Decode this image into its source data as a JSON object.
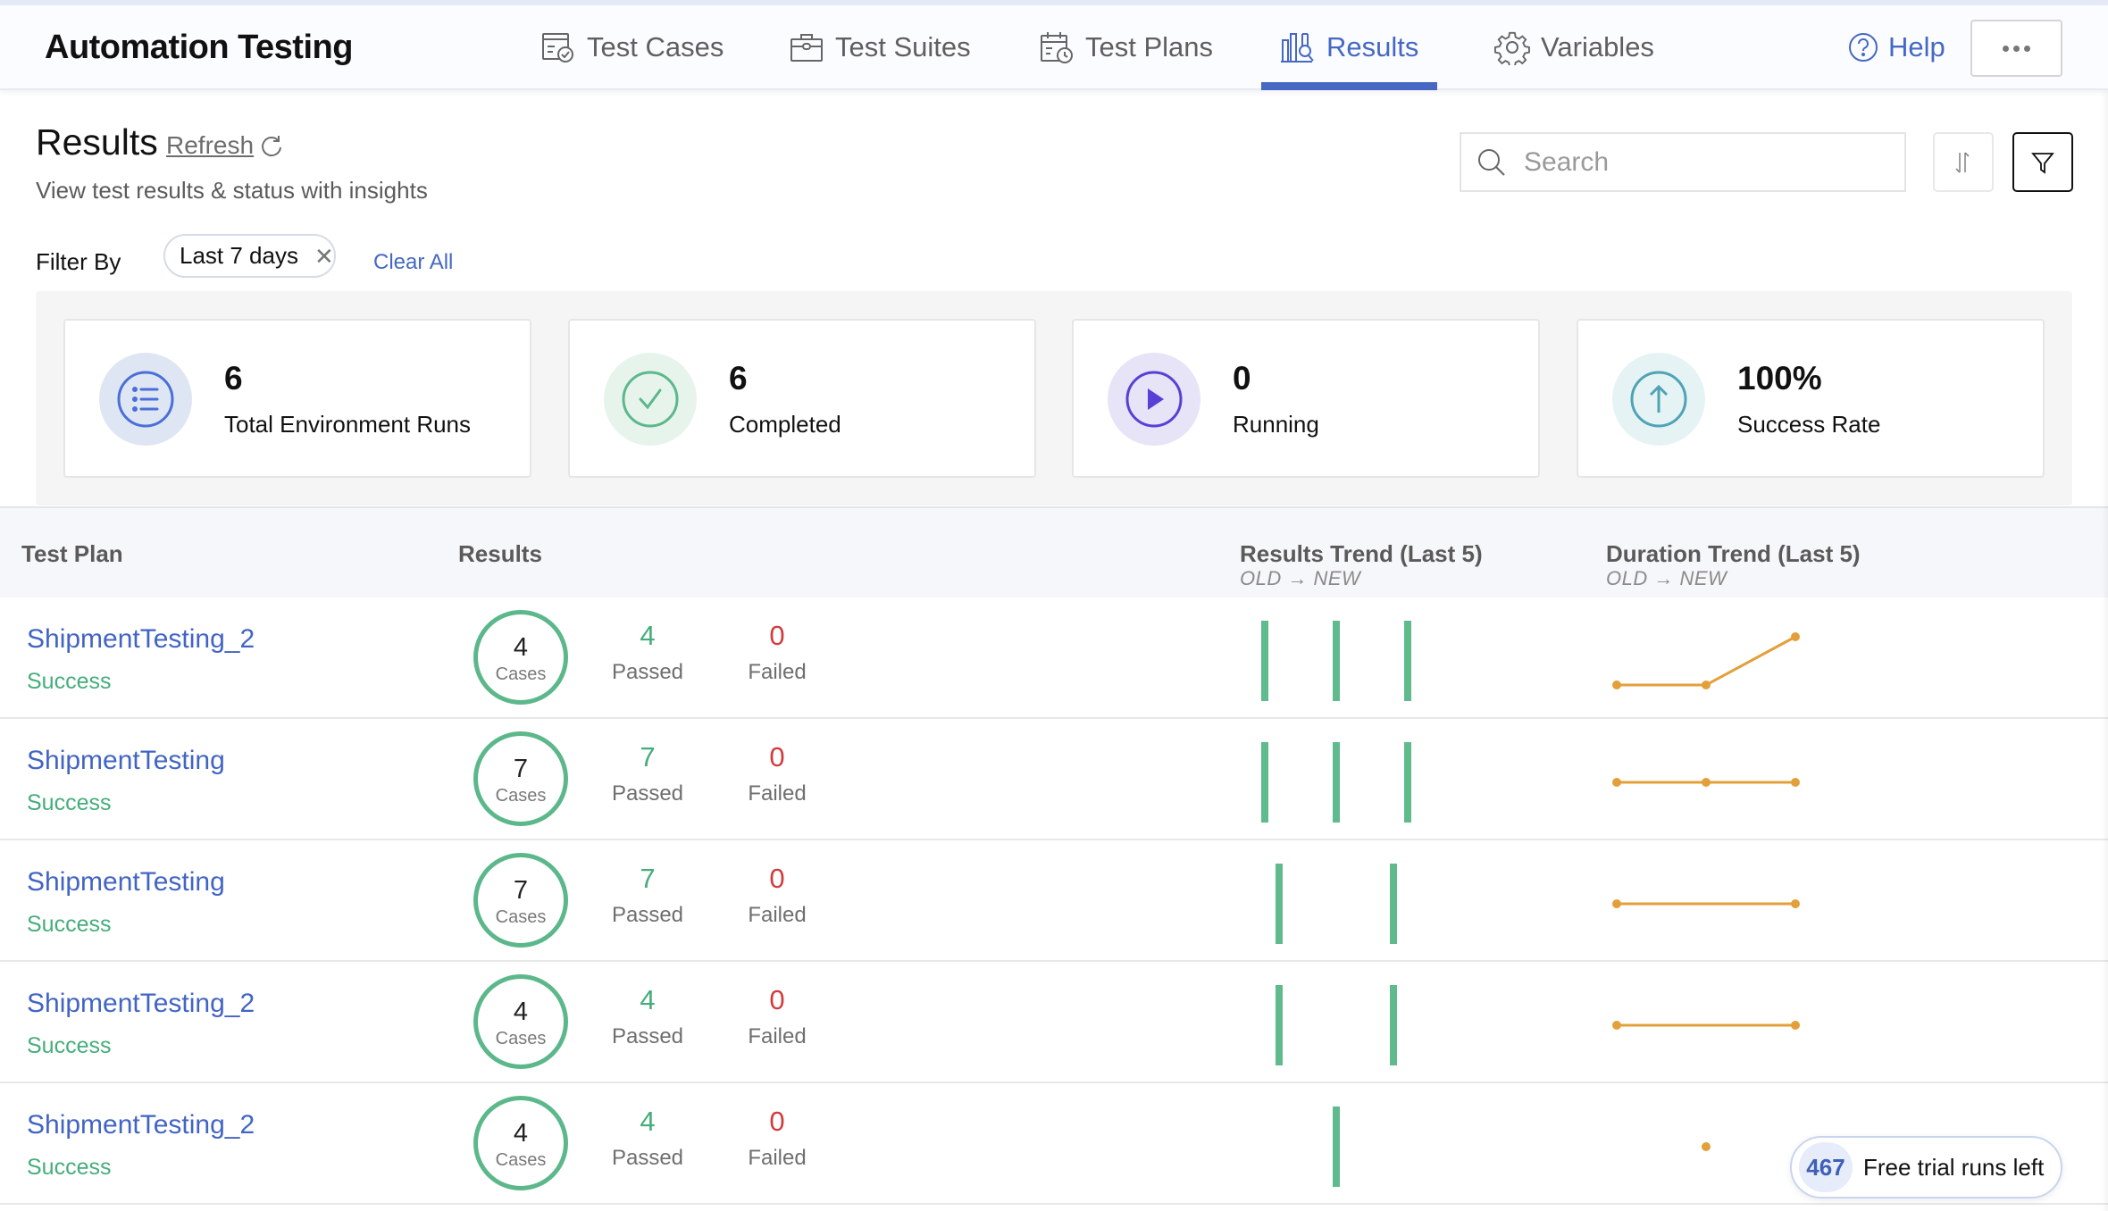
{
  "app": {
    "title": "Automation Testing"
  },
  "nav": {
    "items": [
      {
        "label": "Test Cases",
        "icon": "test-cases-icon",
        "active": false
      },
      {
        "label": "Test Suites",
        "icon": "briefcase-icon",
        "active": false
      },
      {
        "label": "Test Plans",
        "icon": "calendar-clock-icon",
        "active": false
      },
      {
        "label": "Results",
        "icon": "chart-search-icon",
        "active": true
      },
      {
        "label": "Variables",
        "icon": "gear-icon",
        "active": false
      }
    ],
    "help_label": "Help",
    "more_icon": "more-horizontal-icon"
  },
  "page": {
    "title": "Results",
    "refresh_label": "Refresh",
    "subtitle": "View test results & status with insights",
    "filter_label": "Filter By",
    "filter_chip": "Last 7 days",
    "clear_all": "Clear All",
    "search_placeholder": "Search"
  },
  "stats": [
    {
      "value": "6",
      "label": "Total Environment Runs",
      "icon": "list-icon",
      "color": "#4a6fd8",
      "bg": "#dfe6f3"
    },
    {
      "value": "6",
      "label": "Completed",
      "icon": "check-circle-icon",
      "color": "#5cb88b",
      "bg": "#e7f4ec"
    },
    {
      "value": "0",
      "label": "Running",
      "icon": "play-circle-icon",
      "color": "#5a3fd6",
      "bg": "#e6e4f6"
    },
    {
      "value": "100%",
      "label": "Success Rate",
      "icon": "arrow-up-circle-icon",
      "color": "#4fa3b5",
      "bg": "#e6f3f4"
    }
  ],
  "table": {
    "headers": {
      "test_plan": "Test Plan",
      "results": "Results",
      "results_trend": "Results Trend (Last 5)",
      "duration_trend": "Duration Trend (Last 5)",
      "trend_sub_old": "OLD",
      "trend_sub_new": "NEW"
    },
    "labels": {
      "cases": "Cases",
      "passed": "Passed",
      "failed": "Failed"
    },
    "rows": [
      {
        "name": "ShipmentTesting_2",
        "status": "Success",
        "cases": "4",
        "passed": "4",
        "failed": "0",
        "results_trend": [
          1,
          1,
          1
        ],
        "results_trend_slots": [
          0,
          1,
          2
        ],
        "duration_trend": [
          1,
          1,
          3
        ],
        "duration_trend_slots": [
          0,
          1,
          2
        ]
      },
      {
        "name": "ShipmentTesting",
        "status": "Success",
        "cases": "7",
        "passed": "7",
        "failed": "0",
        "results_trend": [
          1,
          1,
          1
        ],
        "results_trend_slots": [
          0,
          1,
          2
        ],
        "duration_trend": [
          2,
          2,
          2
        ],
        "duration_trend_slots": [
          0,
          1,
          2
        ]
      },
      {
        "name": "ShipmentTesting",
        "status": "Success",
        "cases": "7",
        "passed": "7",
        "failed": "0",
        "results_trend": [
          1,
          1
        ],
        "results_trend_slots": [
          0.2,
          1.8
        ],
        "duration_trend": [
          2,
          2
        ],
        "duration_trend_slots": [
          0,
          2
        ]
      },
      {
        "name": "ShipmentTesting_2",
        "status": "Success",
        "cases": "4",
        "passed": "4",
        "failed": "0",
        "results_trend": [
          1,
          1
        ],
        "results_trend_slots": [
          0.2,
          1.8
        ],
        "duration_trend": [
          2,
          2
        ],
        "duration_trend_slots": [
          0,
          2
        ]
      },
      {
        "name": "ShipmentTesting_2",
        "status": "Success",
        "cases": "4",
        "passed": "4",
        "failed": "0",
        "results_trend": [
          1
        ],
        "results_trend_slots": [
          1
        ],
        "duration_trend": [
          2
        ],
        "duration_trend_slots": [
          1
        ]
      }
    ]
  },
  "trial": {
    "count": "467",
    "label": "Free trial runs left"
  },
  "colors": {
    "accent": "#4668c4",
    "success": "#45ad7a",
    "fail": "#d23b3b",
    "trend_bar": "#5fba8e",
    "trend_line": "#e3a03a"
  }
}
